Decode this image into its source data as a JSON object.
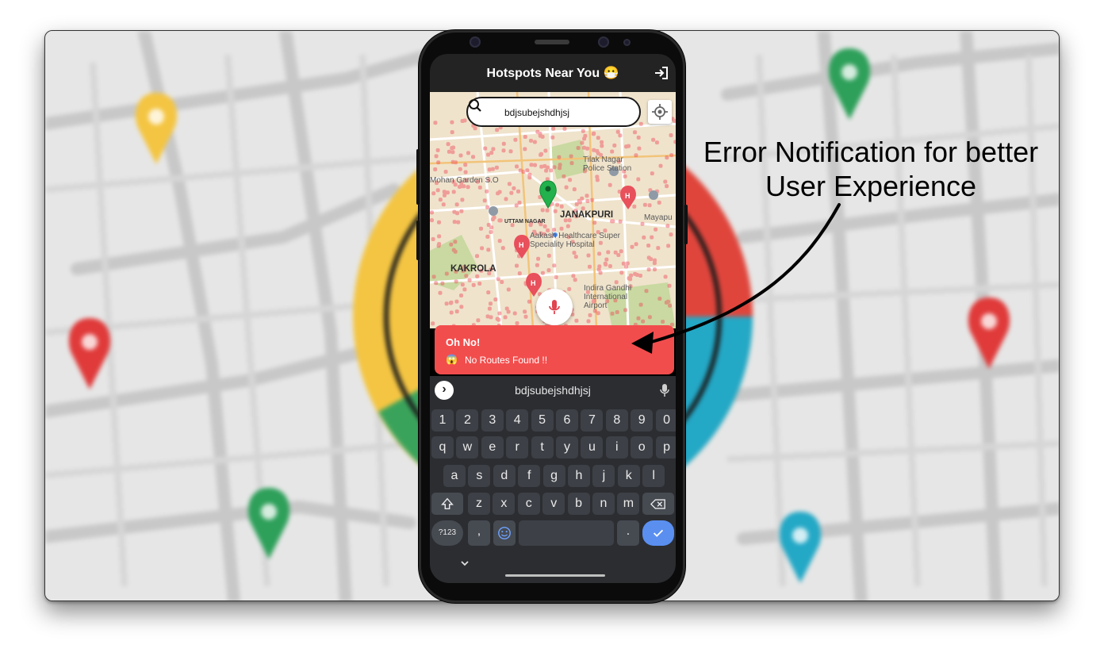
{
  "app": {
    "title": "Hotspots Near You 😷"
  },
  "search": {
    "value": "bdjsubejshdhjsj"
  },
  "map": {
    "labels": {
      "tilak_nagar_ps": "Tilak Nagar\nPolice Station",
      "mohan_garden": "Mohan Garden S.O",
      "janakpuri": "JANAKPURI",
      "uttam_nagar": "UTTAM NAGAR",
      "mayapuri": "Mayapu",
      "aakash": "Aakash Healthcare Super\nSpeciality Hospital",
      "kakrola": "KAKROLA",
      "igi": "Indira Gandhi\nInternational\nAirport"
    }
  },
  "toast": {
    "title": "Oh No!",
    "emoji": "😱",
    "message": "No Routes Found !!",
    "color": "#f24d4d"
  },
  "keyboard": {
    "suggestion": "bdjsubejshdhjsj",
    "row_numbers": [
      "1",
      "2",
      "3",
      "4",
      "5",
      "6",
      "7",
      "8",
      "9",
      "0"
    ],
    "row1": [
      "q",
      "w",
      "e",
      "r",
      "t",
      "y",
      "u",
      "i",
      "o",
      "p"
    ],
    "row2": [
      "a",
      "s",
      "d",
      "f",
      "g",
      "h",
      "j",
      "k",
      "l"
    ],
    "row3": [
      "z",
      "x",
      "c",
      "v",
      "b",
      "n",
      "m"
    ],
    "symbols_label": "?123",
    "comma": ",",
    "period": ".",
    "icons": {
      "shift": "shift-icon",
      "backspace": "backspace-icon",
      "emoji": "emoji-icon",
      "enter": "check-icon",
      "expand": "chevron-right-icon",
      "voice": "mic-icon",
      "hide": "chevron-down-icon"
    }
  },
  "annotation": {
    "text": "Error Notification for better User Experience"
  }
}
